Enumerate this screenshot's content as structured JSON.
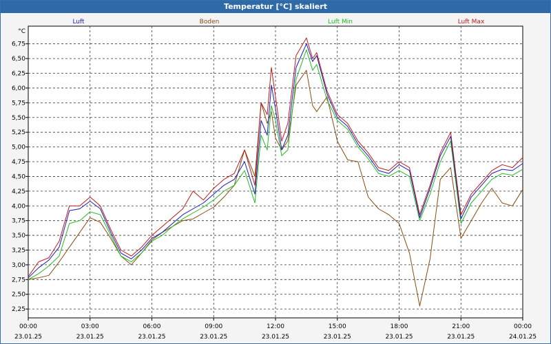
{
  "window": {
    "title": "Temperatur [°C] skaliert"
  },
  "chart_data": {
    "type": "line",
    "ylabel": "°C",
    "ylim": [
      2.1,
      7.05
    ],
    "xlim_hours": [
      0,
      24
    ],
    "y_ticks": [
      "2,25",
      "2,50",
      "2,75",
      "3,00",
      "3,25",
      "3,50",
      "3,75",
      "4,00",
      "4,25",
      "4,50",
      "4,75",
      "5,00",
      "5,25",
      "5,50",
      "5,75",
      "6,00",
      "6,25",
      "6,50",
      "6,75"
    ],
    "y_tick_values": [
      2.25,
      2.5,
      2.75,
      3.0,
      3.25,
      3.5,
      3.75,
      4.0,
      4.25,
      4.5,
      4.75,
      5.0,
      5.25,
      5.5,
      5.75,
      6.0,
      6.25,
      6.5,
      6.75
    ],
    "x_ticks": [
      {
        "time": "00:00",
        "date": "23.01.25"
      },
      {
        "time": "03:00",
        "date": "23.01.25"
      },
      {
        "time": "06:00",
        "date": "23.01.25"
      },
      {
        "time": "09:00",
        "date": "23.01.25"
      },
      {
        "time": "12:00",
        "date": "23.01.25"
      },
      {
        "time": "15:00",
        "date": "23.01.25"
      },
      {
        "time": "18:00",
        "date": "23.01.25"
      },
      {
        "time": "21:00",
        "date": "23.01.25"
      },
      {
        "time": "00:00",
        "date": "24.01.25"
      }
    ],
    "grid": true,
    "legend_position": "top",
    "series": [
      {
        "name": "Luft",
        "color": "#1a1ab8",
        "x": [
          0,
          0.5,
          1,
          1.5,
          2,
          2.5,
          3,
          3.5,
          4,
          4.5,
          5,
          5.5,
          6,
          6.5,
          7,
          7.5,
          8,
          8.5,
          9,
          9.5,
          10,
          10.5,
          11,
          11.3,
          11.6,
          11.8,
          12,
          12.3,
          12.6,
          13,
          13.5,
          13.8,
          14,
          14.5,
          15,
          15.5,
          16,
          16.5,
          17,
          17.5,
          18,
          18.5,
          19,
          19.5,
          20,
          20.5,
          21,
          21.5,
          22,
          22.5,
          23,
          23.5,
          24
        ],
        "y": [
          2.78,
          2.95,
          3.08,
          3.3,
          3.92,
          3.95,
          4.08,
          3.95,
          3.55,
          3.2,
          3.1,
          3.25,
          3.45,
          3.55,
          3.7,
          3.85,
          3.95,
          4.05,
          4.2,
          4.35,
          4.45,
          4.75,
          4.2,
          5.45,
          5.2,
          6.05,
          5.65,
          4.95,
          5.2,
          6.35,
          6.75,
          6.45,
          6.55,
          5.9,
          5.5,
          5.35,
          5.05,
          4.85,
          4.6,
          4.55,
          4.7,
          4.6,
          3.8,
          4.3,
          4.85,
          5.18,
          3.78,
          4.15,
          4.35,
          4.55,
          4.62,
          4.6,
          4.72
        ]
      },
      {
        "name": "Boden",
        "color": "#8b4a0c",
        "x": [
          0,
          0.5,
          1,
          1.5,
          2,
          2.5,
          3,
          3.5,
          4,
          4.5,
          5,
          5.5,
          6,
          6.5,
          7,
          7.5,
          8,
          8.5,
          9,
          9.5,
          10,
          10.5,
          11,
          11.3,
          11.6,
          11.8,
          12,
          12.3,
          12.6,
          13,
          13.5,
          13.8,
          14,
          14.5,
          15,
          15.5,
          16,
          16.5,
          17,
          17.5,
          18,
          18.5,
          19,
          19.5,
          20,
          20.5,
          21,
          21.5,
          22,
          22.5,
          23,
          23.5,
          24
        ],
        "y": [
          2.75,
          2.78,
          2.82,
          3.05,
          3.3,
          3.55,
          3.8,
          3.72,
          3.45,
          3.15,
          3.0,
          3.2,
          3.42,
          3.55,
          3.65,
          3.75,
          3.78,
          3.88,
          3.98,
          4.15,
          4.35,
          4.95,
          4.5,
          5.75,
          5.4,
          5.6,
          5.15,
          4.95,
          5.1,
          6.05,
          6.3,
          5.7,
          5.6,
          5.85,
          5.1,
          4.78,
          4.75,
          4.15,
          3.95,
          3.85,
          3.7,
          3.2,
          2.3,
          3.1,
          4.45,
          4.65,
          3.45,
          3.75,
          4.05,
          4.3,
          4.05,
          4.0,
          4.28
        ]
      },
      {
        "name": "Luft Min",
        "color": "#22bb22",
        "x": [
          0,
          0.5,
          1,
          1.5,
          2,
          2.5,
          3,
          3.5,
          4,
          4.5,
          5,
          5.5,
          6,
          6.5,
          7,
          7.5,
          8,
          8.5,
          9,
          9.5,
          10,
          10.5,
          11,
          11.3,
          11.6,
          11.8,
          12,
          12.3,
          12.6,
          13,
          13.5,
          13.8,
          14,
          14.5,
          15,
          15.5,
          16,
          16.5,
          17,
          17.5,
          18,
          18.5,
          19,
          19.5,
          20,
          20.5,
          21,
          21.5,
          22,
          22.5,
          23,
          23.5,
          24
        ],
        "y": [
          2.75,
          2.85,
          2.98,
          3.15,
          3.7,
          3.75,
          3.9,
          3.85,
          3.5,
          3.15,
          3.05,
          3.2,
          3.4,
          3.5,
          3.65,
          3.78,
          3.88,
          3.98,
          4.1,
          4.25,
          4.35,
          4.6,
          4.05,
          5.2,
          4.95,
          5.7,
          5.45,
          4.85,
          4.95,
          6.15,
          6.65,
          6.3,
          6.4,
          5.8,
          5.45,
          5.3,
          5.0,
          4.8,
          4.55,
          4.5,
          4.6,
          4.5,
          3.75,
          4.2,
          4.75,
          5.1,
          3.7,
          4.05,
          4.25,
          4.45,
          4.55,
          4.52,
          4.62
        ]
      },
      {
        "name": "Luft Max",
        "color": "#c01818",
        "x": [
          0,
          0.5,
          1,
          1.5,
          2,
          2.5,
          3,
          3.5,
          4,
          4.5,
          5,
          5.5,
          6,
          6.5,
          7,
          7.5,
          8,
          8.5,
          9,
          9.5,
          10,
          10.5,
          11,
          11.3,
          11.6,
          11.8,
          12,
          12.3,
          12.6,
          13,
          13.5,
          13.8,
          14,
          14.5,
          15,
          15.5,
          16,
          16.5,
          17,
          17.5,
          18,
          18.5,
          19,
          19.5,
          20,
          20.5,
          21,
          21.5,
          22,
          22.5,
          23,
          23.5,
          24
        ],
        "y": [
          2.8,
          3.05,
          3.12,
          3.4,
          4.0,
          4.0,
          4.15,
          4.0,
          3.6,
          3.25,
          3.15,
          3.3,
          3.5,
          3.65,
          3.8,
          3.95,
          4.25,
          4.1,
          4.3,
          4.45,
          4.55,
          4.95,
          4.35,
          5.75,
          5.55,
          6.35,
          5.85,
          5.1,
          5.4,
          6.55,
          6.85,
          6.5,
          6.6,
          5.95,
          5.55,
          5.4,
          5.1,
          4.9,
          4.65,
          4.6,
          4.75,
          4.65,
          3.85,
          4.35,
          4.9,
          5.25,
          3.85,
          4.2,
          4.4,
          4.6,
          4.7,
          4.65,
          4.82
        ]
      }
    ]
  }
}
